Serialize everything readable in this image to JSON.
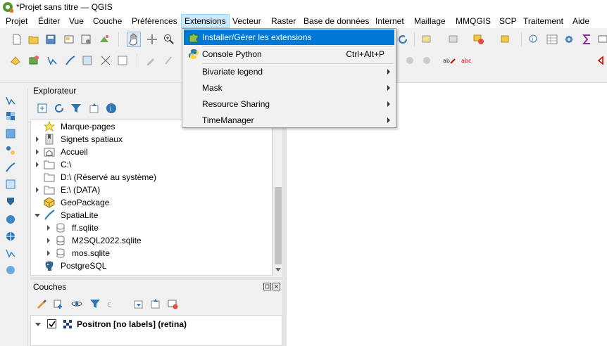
{
  "window": {
    "title": "*Projet sans titre — QGIS"
  },
  "menubar": {
    "items": [
      {
        "label": "Projet"
      },
      {
        "label": "Éditer"
      },
      {
        "label": "Vue"
      },
      {
        "label": "Couche"
      },
      {
        "label": "Préférences"
      },
      {
        "label": "Extensions"
      },
      {
        "label": "Vecteur"
      },
      {
        "label": "Raster"
      },
      {
        "label": "Base de données"
      },
      {
        "label": "Internet"
      },
      {
        "label": "Maillage"
      },
      {
        "label": "MMQGIS"
      },
      {
        "label": "SCP"
      },
      {
        "label": "Traitement"
      },
      {
        "label": "Aide"
      }
    ],
    "active": "Extensions"
  },
  "extensions_menu": {
    "items": [
      {
        "label": "Installer/Gérer les extensions",
        "icon": "puzzle-icon",
        "highlighted": true
      },
      {
        "label": "Console Python",
        "icon": "python-icon",
        "shortcut": "Ctrl+Alt+P"
      },
      {
        "label": "Bivariate legend",
        "submenu": true
      },
      {
        "label": "Mask",
        "submenu": true
      },
      {
        "label": "Resource Sharing",
        "submenu": true
      },
      {
        "label": "TimeManager",
        "submenu": true
      }
    ]
  },
  "explorer": {
    "title": "Explorateur",
    "items": [
      {
        "label": "Marque-pages",
        "icon": "star-icon",
        "arrow": "none"
      },
      {
        "label": "Signets spatiaux",
        "icon": "bookmark-icon",
        "arrow": "closed"
      },
      {
        "label": "Accueil",
        "icon": "home-folder-icon",
        "arrow": "closed"
      },
      {
        "label": "C:\\",
        "icon": "folder-icon",
        "arrow": "closed"
      },
      {
        "label": "D:\\ (Réservé au système)",
        "icon": "folder-icon",
        "arrow": "none"
      },
      {
        "label": "E:\\ (DATA)",
        "icon": "folder-icon",
        "arrow": "closed"
      },
      {
        "label": "GeoPackage",
        "icon": "geopackage-icon",
        "arrow": "none"
      },
      {
        "label": "SpatiaLite",
        "icon": "spatialite-icon",
        "arrow": "open"
      },
      {
        "label": "ff.sqlite",
        "icon": "database-icon",
        "arrow": "closed",
        "indent": 1
      },
      {
        "label": "M2SQL2022.sqlite",
        "icon": "database-icon",
        "arrow": "closed",
        "indent": 1
      },
      {
        "label": "mos.sqlite",
        "icon": "database-icon",
        "arrow": "closed",
        "indent": 1
      },
      {
        "label": "PostgreSQL",
        "icon": "postgresql-icon",
        "arrow": "none"
      }
    ]
  },
  "layers": {
    "title": "Couches",
    "items": [
      {
        "label": "Positron [no labels] (retina)",
        "checked": true
      }
    ]
  },
  "colors": {
    "menu_highlight": "#0078d7",
    "active_menu_bg": "#cce8ff",
    "qgis_green": "#589632"
  }
}
